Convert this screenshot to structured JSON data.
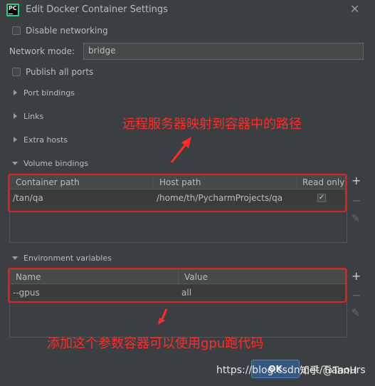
{
  "window": {
    "title": "Edit Docker Container Settings",
    "close_glyph": "✕",
    "app_icon_text": "PC"
  },
  "options": {
    "disable_networking": {
      "label": "Disable networking",
      "checked": false
    },
    "network_mode": {
      "label": "Network mode:",
      "value": "bridge"
    },
    "publish_all_ports": {
      "label": "Publish all ports",
      "checked": false
    }
  },
  "sections": {
    "port_bindings": "Port bindings",
    "links": "Links",
    "extra_hosts": "Extra hosts",
    "volume_bindings": "Volume bindings",
    "environment_variables": "Environment variables"
  },
  "volume_table": {
    "headers": [
      "Container path",
      "Host path",
      "Read only"
    ],
    "rows": [
      {
        "container_path": "/tan/qa",
        "host_path": "/home/th/PycharmProjects/qa",
        "read_only": true
      }
    ]
  },
  "env_table": {
    "headers": [
      "Name",
      "Value"
    ],
    "rows": [
      {
        "name": "--gpus",
        "value": "all"
      }
    ]
  },
  "annotations": {
    "volume_note": "远程服务器映射到容器中的路径",
    "env_note": "添加这个参数容器可以使用gpu跑代码"
  },
  "footer": {
    "ok_label": "OK",
    "watermark_url": "https://blog.csdn.net/Tianours",
    "watermark_zhihu": "知乎 @TanH"
  },
  "colors": {
    "annotation": "#ff2a2a",
    "background": "#3c3f41",
    "ok_button": "#365880"
  }
}
